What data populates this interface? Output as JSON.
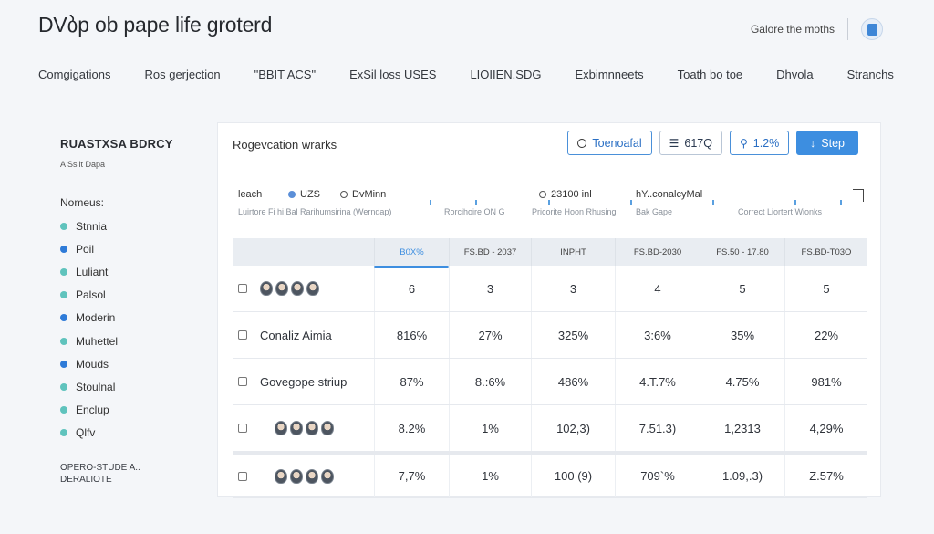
{
  "app": {
    "title": "DVბp ob pape life groterd"
  },
  "header": {
    "link": "Galore the moths",
    "avatar_icon": "user-avatar-icon"
  },
  "topnav": {
    "items": [
      {
        "label": "Comgigations"
      },
      {
        "label": "Ros gerjection"
      },
      {
        "label": "\"BBIT ACS\""
      },
      {
        "label": "ExSil loss USES"
      },
      {
        "label": "LIOIIEN.SDG"
      },
      {
        "label": "Exbimnneets"
      },
      {
        "label": "Toath bo toe"
      },
      {
        "label": "Dhvola"
      },
      {
        "label": "Stranchs"
      }
    ]
  },
  "left_panel": {
    "title": "RUASTXSA BDRCY",
    "subtitle": "A Ssiit Dapa",
    "section_label": "Nomeus:",
    "items": [
      {
        "label": "Stnnia",
        "color": "#5fc3bd"
      },
      {
        "label": "Poil",
        "color": "#2e7bd8"
      },
      {
        "label": "Luliant",
        "color": "#5fc3bd"
      },
      {
        "label": "Palsol",
        "color": "#5fc3bd"
      },
      {
        "label": "Moderin",
        "color": "#2e7bd8"
      },
      {
        "label": "Muhettel",
        "color": "#5fc3bd"
      },
      {
        "label": "Mouds",
        "color": "#2e7bd8"
      },
      {
        "label": "Stoulnal",
        "color": "#5fc3bd"
      },
      {
        "label": "Enclup",
        "color": "#5fc3bd"
      },
      {
        "label": "Qlfv",
        "color": "#5fc3bd"
      }
    ],
    "footer_line1": "OPERO-STUDE A..",
    "footer_line2": "DERALIOTE"
  },
  "main": {
    "title": "Rogevcation wrarks",
    "toolbar": {
      "btn1": "Toenoafal",
      "btn2": "617Q",
      "btn3": "1.2%",
      "btn_primary": "Step"
    },
    "filters": {
      "search": "leach",
      "radio1": "UZS",
      "radio2": "DvMinn",
      "center": "23100 inl",
      "right": "hY..conalcyMal",
      "sub1": "Luirtore Fi hi Bal Rarihumsirina (Werndap)",
      "sub2": "Rorcihoire ON G",
      "sub3": "Pricorite Hoon Rhusing",
      "sub4": "Bak Gape",
      "sub5": "Correct Liortert Wionks"
    },
    "table": {
      "headers": [
        "",
        "B0X%",
        "FS.BD - 2037",
        "INPHT",
        "FS.BD-2030",
        "FS.50 - 17.80",
        "FS.BD-T03O"
      ],
      "rows": [
        {
          "name": "",
          "faces": true,
          "values": [
            "6",
            "3",
            "3",
            "4",
            "5",
            "5"
          ]
        },
        {
          "name": "Conaliz Aimia",
          "faces": false,
          "values": [
            "816%",
            "27%",
            "325%",
            "3:6%",
            "35%",
            "22%"
          ]
        },
        {
          "name": "Govegope striup",
          "faces": false,
          "values": [
            "87%",
            "8.:6%",
            "486%",
            "4.T.7%",
            "4.75%",
            "981%"
          ]
        },
        {
          "name": "",
          "faces": true,
          "values": [
            "8.2%",
            "1%",
            "102,3)",
            "7.51.3)",
            "1,2313",
            "4,29%"
          ]
        },
        {
          "name": "",
          "faces": true,
          "values": [
            "7,7%",
            "1%",
            "100 (9)",
            "709`%",
            "1.09,.3)",
            "Z.57%"
          ]
        }
      ]
    }
  }
}
